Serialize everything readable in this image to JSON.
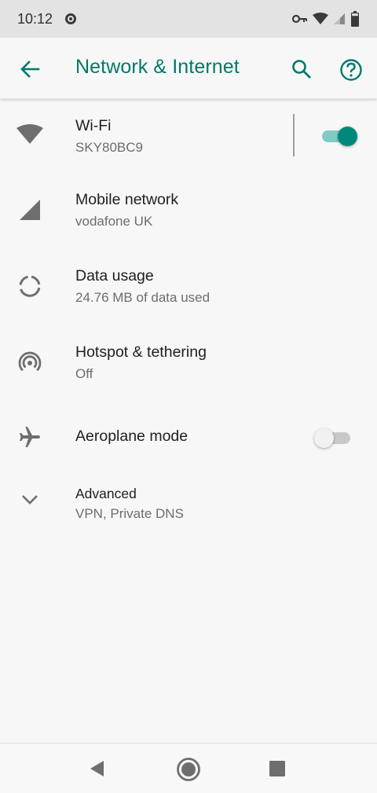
{
  "status_bar": {
    "time": "10:12",
    "battery_level": "79"
  },
  "app_bar": {
    "title": "Network & Internet",
    "accent_color": "#00796b"
  },
  "items": [
    {
      "id": "wifi",
      "icon": "wifi-icon",
      "title": "Wi-Fi",
      "subtitle": "SKY80BC9",
      "toggle": true
    },
    {
      "id": "mobile",
      "icon": "signal-icon",
      "title": "Mobile network",
      "subtitle": "vodafone UK"
    },
    {
      "id": "data",
      "icon": "data-usage-icon",
      "title": "Data usage",
      "subtitle": "24.76 MB of data used"
    },
    {
      "id": "hotspot",
      "icon": "hotspot-icon",
      "title": "Hotspot & tethering",
      "subtitle": "Off"
    },
    {
      "id": "aeroplane",
      "icon": "airplane-icon",
      "title": "Aeroplane mode",
      "toggle": false
    },
    {
      "id": "advanced",
      "icon": "chevron-down-icon",
      "title": "Advanced",
      "subtitle": "VPN, Private DNS"
    }
  ]
}
